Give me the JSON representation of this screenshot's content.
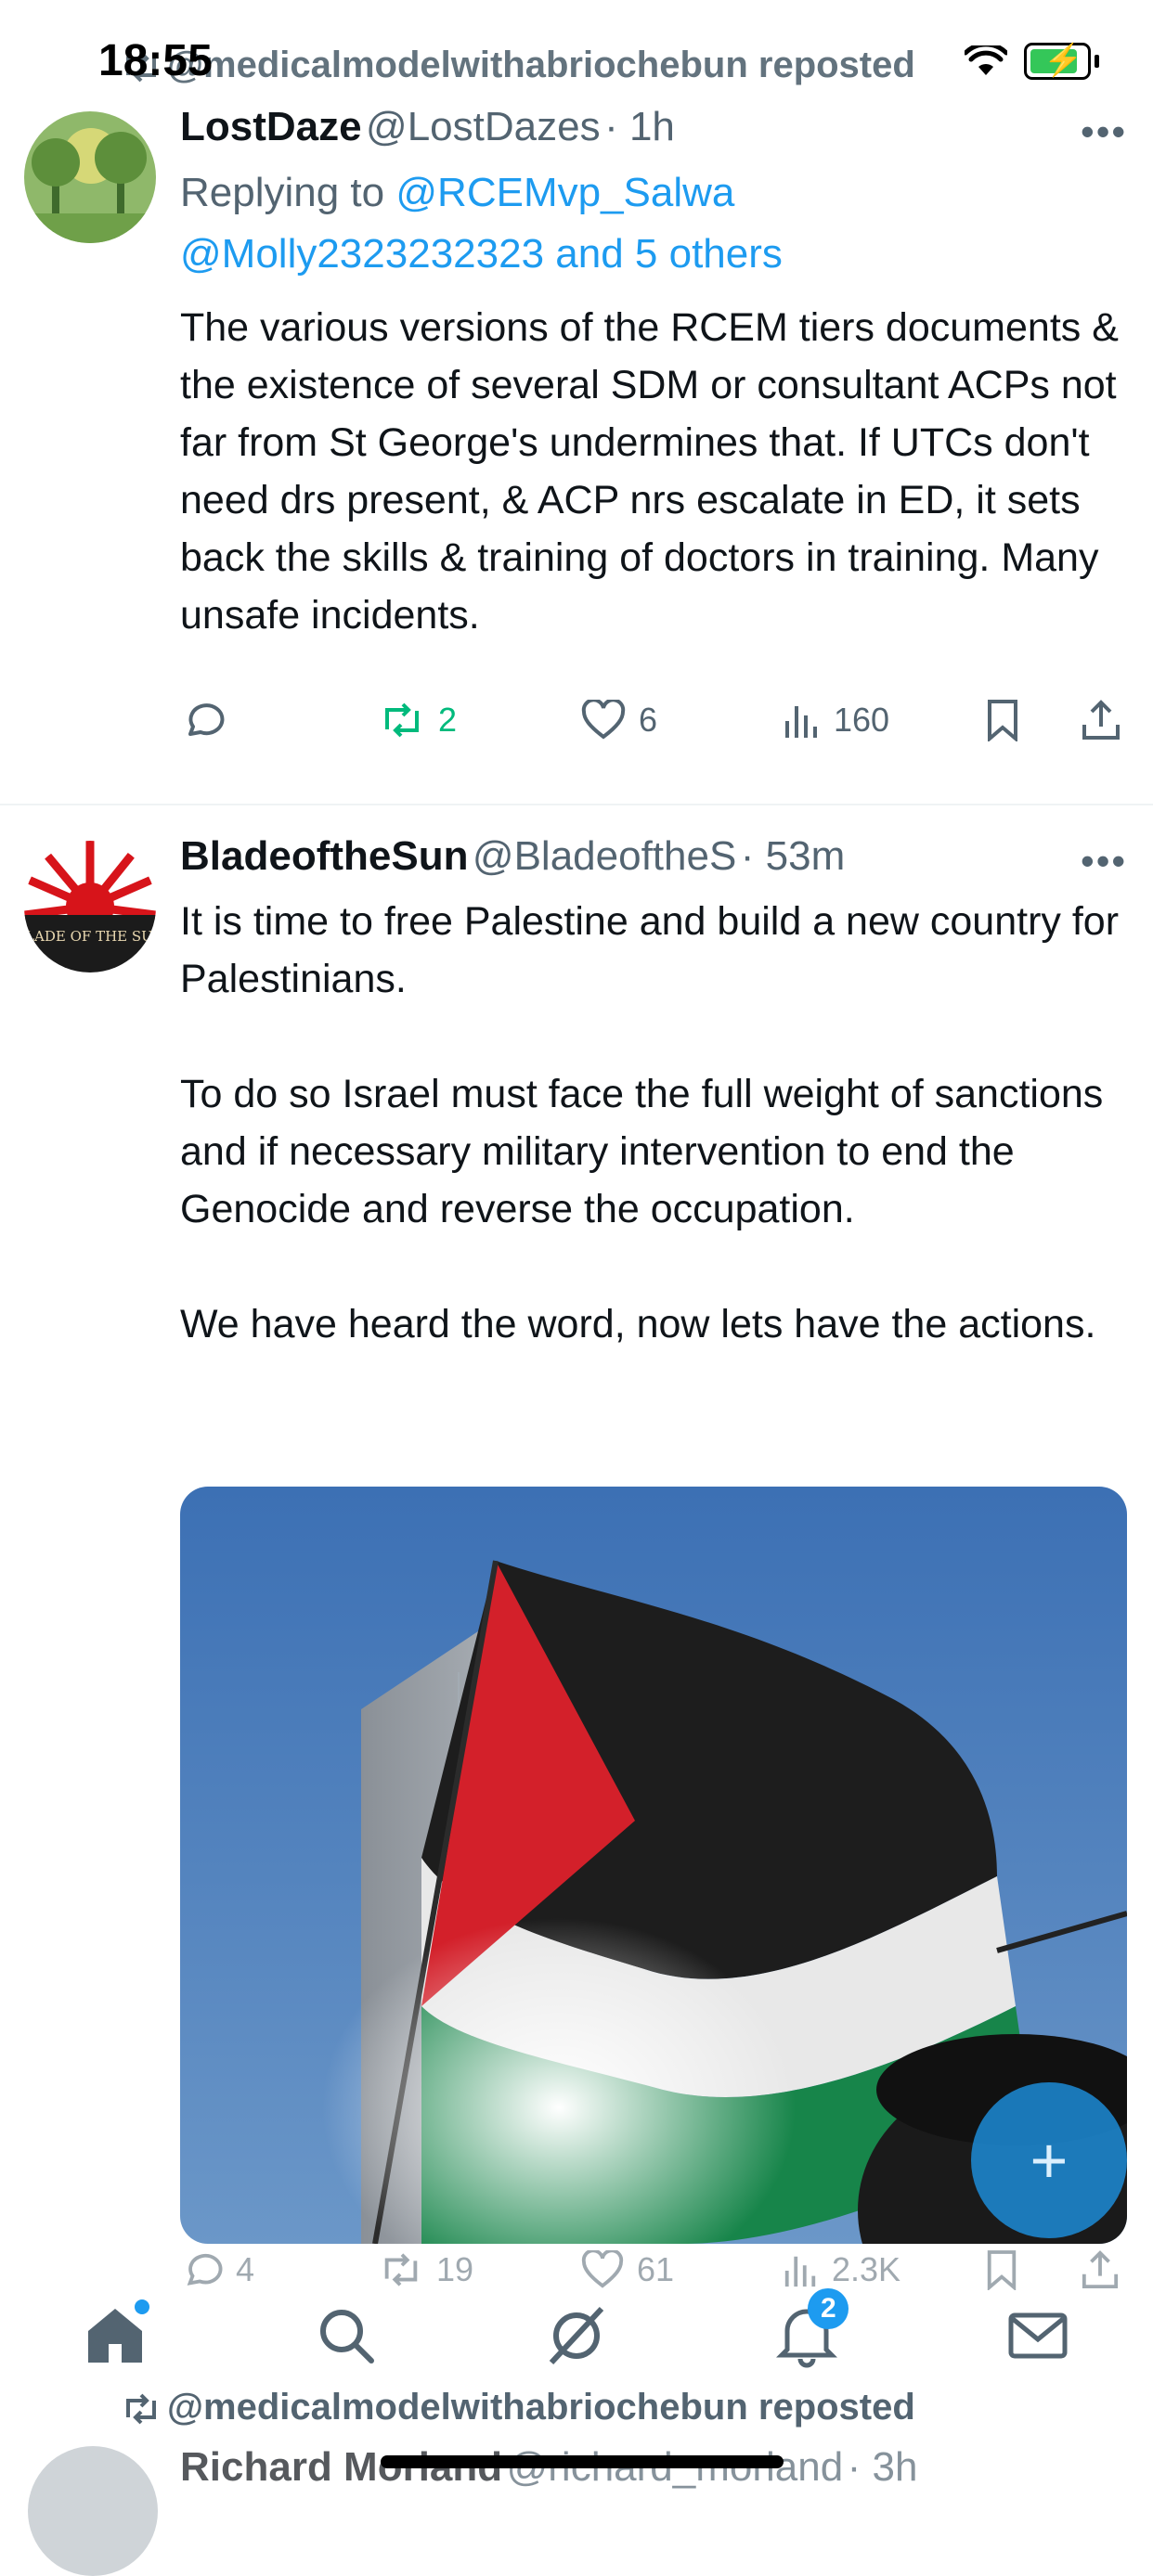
{
  "status_bar": {
    "time": "18:55"
  },
  "top_repost": {
    "text": "@medicalmodelwithabriochebun reposted"
  },
  "tweet1": {
    "name": "LostDaze",
    "handle": "@LostDazes",
    "time": "· 1h",
    "replying_prefix": "Replying to",
    "reply_to_1": "@RCEMvp_Salwa",
    "reply_to_2": "@Molly2323232323 and 5 others",
    "text": "The various versions of the RCEM tiers documents & the existence of several SDM or consultant ACPs not far from St George's undermines that. If UTCs don't need drs present, & ACP nrs escalate in ED, it sets back the skills & training of doctors in training. Many unsafe incidents.",
    "reposts": "2",
    "likes": "6",
    "views": "160"
  },
  "tweet2": {
    "name": "BladeoftheSun",
    "handle": "@BladeoftheS",
    "time": "· 53m",
    "text": "It is time to free Palestine and build a new country for Palestinians.\n\nTo do so Israel must face the full weight of sanctions and if necessary military intervention to end the Genocide and reverse the occupation.\n\nWe have heard the word, now lets have the actions.",
    "avatar_text": "BLADE OF THE SUN",
    "replies": "4",
    "reposts": "19",
    "likes": "61",
    "views": "2.3K"
  },
  "tweet3": {
    "repost_text": "@medicalmodelwithabriochebun reposted",
    "name": "Richard Morland",
    "handle": "@richard_morland",
    "time": "· 3h"
  },
  "nav": {
    "notifications_badge": "2"
  },
  "colors": {
    "accent": "#1d9bf0",
    "repost_green": "#00ba7c",
    "text": "#0f1419",
    "secondary": "#536471"
  }
}
